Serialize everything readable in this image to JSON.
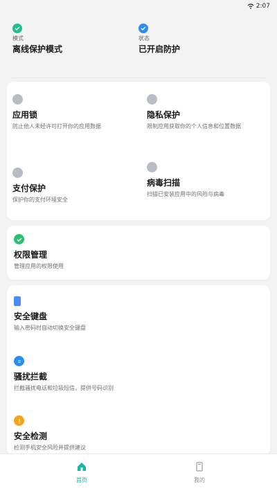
{
  "status_bar": {
    "time": "2:07"
  },
  "top_status": [
    {
      "label": "模式",
      "value": "离线保护模式",
      "color": "#1fbf8f",
      "icon": "check-icon"
    },
    {
      "label": "状态",
      "value": "已开启防护",
      "color": "#2d8cf0",
      "icon": "shield-icon"
    }
  ],
  "grid": [
    {
      "title": "应用锁",
      "desc": "防止他人未经许可打开你的应用数据",
      "icon": "lock-icon"
    },
    {
      "title": "隐私保护",
      "desc": "限制应用获取你的个人信息和位置数据",
      "icon": "privacy-icon"
    },
    {
      "title": "支付保护",
      "desc": "保护你的支付环境安全",
      "icon": "wallet-icon"
    },
    {
      "title": "病毒扫描",
      "desc": "扫描已安装应用中的风险与病毒",
      "icon": "virus-scan-icon"
    }
  ],
  "feature": {
    "title": "权限管理",
    "desc": "管理应用的权限使用",
    "icon": "permission-icon"
  },
  "list": [
    {
      "title": "安全键盘",
      "desc": "输入密码时自动切换安全键盘",
      "icon": "keyboard-icon",
      "color": "#4b8df8"
    },
    {
      "title": "骚扰拦截",
      "desc": "拦截骚扰电话和垃圾短信，提供号码识别",
      "icon": "block-icon",
      "color": "#2d8cf0"
    },
    {
      "title": "安全检测",
      "desc": "检测手机安全风险并提供建议",
      "icon": "alert-icon",
      "color": "#f7a21b"
    }
  ],
  "nav": [
    {
      "label": "首页",
      "active": true,
      "icon": "home-icon"
    },
    {
      "label": "我的",
      "active": false,
      "icon": "profile-icon"
    }
  ],
  "colors": {
    "accent": "#18b6a8",
    "muted": "#9aa0a6"
  }
}
